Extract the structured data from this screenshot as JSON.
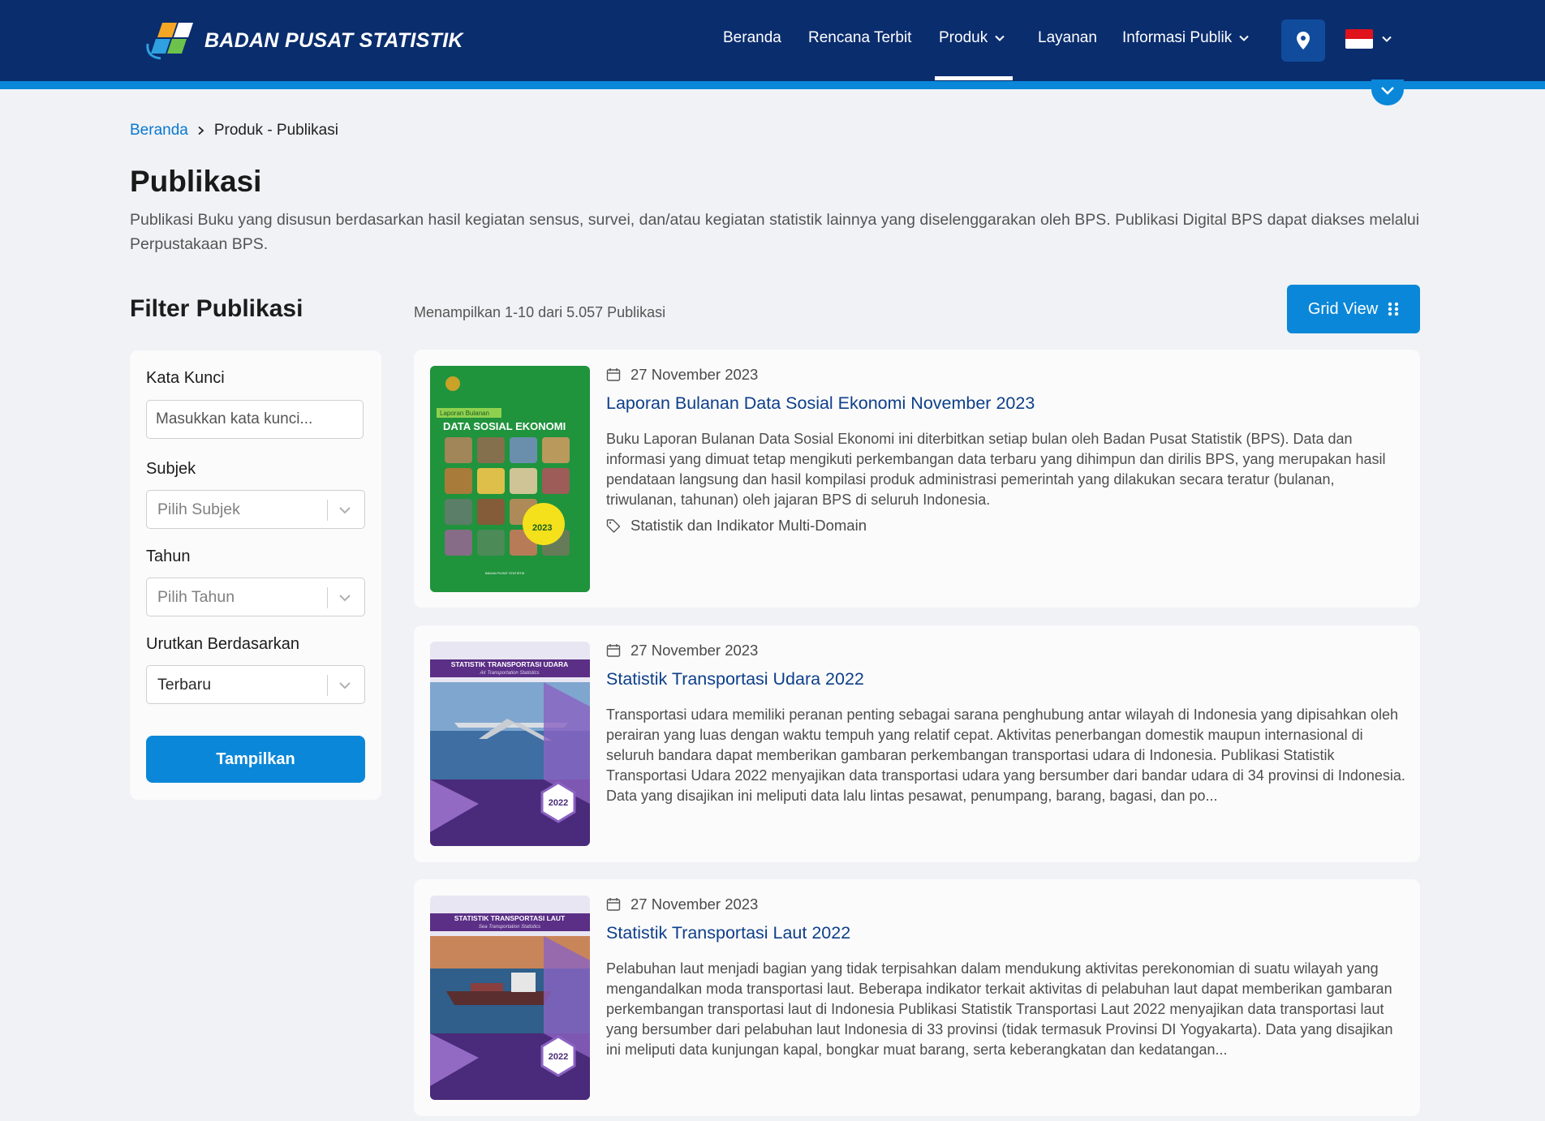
{
  "header": {
    "brand": "BADAN PUSAT STATISTIK",
    "nav": [
      {
        "label": "Beranda",
        "has_dropdown": false
      },
      {
        "label": "Rencana Terbit",
        "has_dropdown": false
      },
      {
        "label": "Produk",
        "has_dropdown": true,
        "active": true
      },
      {
        "label": "Layanan",
        "has_dropdown": false
      },
      {
        "label": "Informasi Publik",
        "has_dropdown": true
      }
    ],
    "location_icon": "map-pin-icon",
    "language_icon": "indonesia-flag-icon",
    "colors": {
      "navy": "#0a2d6e",
      "accent": "#0a87d8"
    }
  },
  "breadcrumb": {
    "home": "Beranda",
    "current": "Produk - Publikasi"
  },
  "page": {
    "title": "Publikasi",
    "description": "Publikasi Buku yang disusun berdasarkan hasil kegiatan sensus, survei, dan/atau kegiatan statistik lainnya yang diselenggarakan oleh BPS. Publikasi Digital BPS dapat diakses melalui Perpustakaan BPS."
  },
  "filter": {
    "title": "Filter Publikasi",
    "keyword_label": "Kata Kunci",
    "keyword_placeholder": "Masukkan kata kunci...",
    "keyword_value": "",
    "subject_label": "Subjek",
    "subject_value": "Pilih Subjek",
    "year_label": "Tahun",
    "year_value": "Pilih Tahun",
    "sort_label": "Urutkan Berdasarkan",
    "sort_value": "Terbaru",
    "apply_label": "Tampilkan"
  },
  "results": {
    "count_text": "Menampilkan 1-10 dari 5.057 Publikasi",
    "view_button": "Grid View",
    "items": [
      {
        "date": "27 November 2023",
        "title": "Laporan Bulanan Data Sosial Ekonomi November 2023",
        "abstract": "Buku Laporan Bulanan Data Sosial Ekonomi ini diterbitkan setiap bulan oleh Badan Pusat Statistik (BPS). Data dan informasi yang dimuat tetap mengikuti perkembangan data terbaru yang dihimpun dan dirilis BPS, yang merupakan hasil pendataan langsung dan hasil kompilasi produk administrasi pemerintah yang dilakukan secara teratur (bulanan, triwulanan, tahunan) oleh jajaran BPS di seluruh Indonesia.",
        "tag": "Statistik dan Indikator Multi-Domain",
        "cover": {
          "header_small": "Laporan Bulanan",
          "header": "DATA SOSIAL EKONOMI",
          "badge": "2023",
          "footer": "BADAN PUSAT STATISTIK",
          "color": "#1e8c3a"
        }
      },
      {
        "date": "27 November 2023",
        "title": "Statistik Transportasi Udara 2022",
        "abstract": "Transportasi udara memiliki peranan penting sebagai sarana penghubung antar wilayah di Indonesia yang dipisahkan oleh perairan yang luas dengan waktu tempuh yang relatif cepat. Aktivitas penerbangan domestik maupun internasional di seluruh bandara dapat memberikan gambaran perkembangan transportasi udara di Indonesia. Publikasi Statistik Transportasi Udara 2022 menyajikan data transportasi udara yang bersumber dari bandar udara di 34 provinsi di Indonesia. Data yang disajikan ini meliputi data lalu lintas pesawat, penumpang, barang, bagasi, dan po...",
        "tag": "",
        "cover": {
          "header": "STATISTIK TRANSPORTASI UDARA",
          "subheader": "Air Transportation Statistics",
          "badge": "2022",
          "color": "#6a3fa0"
        }
      },
      {
        "date": "27 November 2023",
        "title": "Statistik Transportasi Laut 2022",
        "abstract": "Pelabuhan laut menjadi bagian yang tidak terpisahkan dalam mendukung aktivitas perekonomian di suatu wilayah yang mengandalkan moda transportasi laut. Beberapa indikator terkait aktivitas di pelabuhan laut dapat memberikan gambaran perkembangan transportasi laut di Indonesia Publikasi Statistik Transportasi Laut 2022 menyajikan data transportasi laut yang bersumber dari pelabuhan laut Indonesia di 33 provinsi (tidak termasuk Provinsi DI Yogyakarta). Data yang disajikan ini meliputi data kunjungan kapal, bongkar muat barang, serta keberangkatan dan kedatangan...",
        "tag": "",
        "cover": {
          "header": "STATISTIK TRANSPORTASI LAUT",
          "subheader": "Sea Transportation Statistics",
          "badge": "2022",
          "color": "#6a3fa0"
        }
      }
    ]
  }
}
